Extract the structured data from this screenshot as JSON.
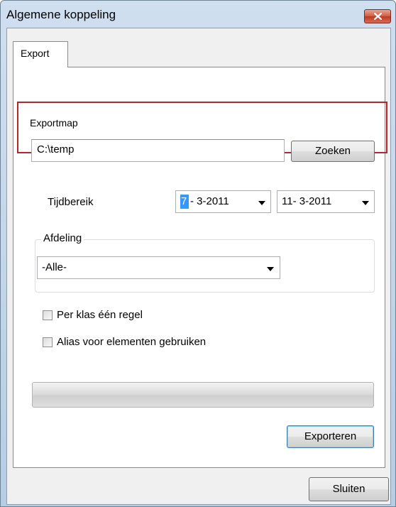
{
  "window": {
    "title": "Algemene koppeling"
  },
  "tabs": [
    {
      "label": "Export"
    }
  ],
  "export_folder": {
    "label": "Exportmap",
    "value": "C:\\temp",
    "browse_label": "Zoeken"
  },
  "time_range": {
    "label": "Tijdbereik",
    "from_day": "7",
    "from_rest": "- 3-2011",
    "to_value": "11- 3-2011"
  },
  "department": {
    "group_label": "Afdeling",
    "selected": "-Alle-"
  },
  "options": [
    {
      "label": "Per klas één regel",
      "checked": false
    },
    {
      "label": "Alias voor elementen gebruiken",
      "checked": false
    }
  ],
  "progress": {
    "value": 0
  },
  "actions": {
    "export_label": "Exporteren",
    "close_label": "Sluiten"
  },
  "colors": {
    "highlight": "#b3262d",
    "selection": "#3399ff"
  }
}
